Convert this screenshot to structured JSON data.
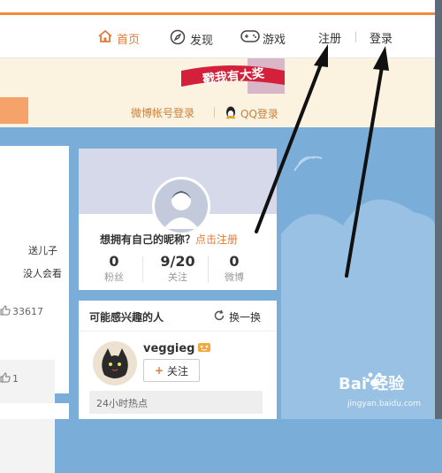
{
  "nav": {
    "home_label": "首页",
    "discover_label": "发现",
    "games_label": "游戏",
    "register_label": "注册",
    "login_label": "登录"
  },
  "banner": {
    "promo_text": "戳我有大奖",
    "weibo_login": "微博帐号登录",
    "qq_login": "QQ登录"
  },
  "left_feed": {
    "text_line1": "送儿子",
    "text_line2": "没人会看",
    "like_count": "33617",
    "like_count2": "1"
  },
  "profile": {
    "prompt_text": "想拥有自己的昵称？",
    "prompt_link": "点击注册",
    "stats": [
      {
        "value": "0",
        "label": "粉丝"
      },
      {
        "value": "9/20",
        "label": "关注"
      },
      {
        "value": "0",
        "label": "微博"
      }
    ]
  },
  "interest": {
    "title": "可能感兴趣的人",
    "refresh_label": "换一换",
    "user_name": "veggieg",
    "follow_label": "关注",
    "hot_label": "24小时热点"
  },
  "watermark": {
    "brand": "Bai 经验",
    "url": "jingyan.baidu.com"
  },
  "colors": {
    "accent": "#e07b39",
    "sky": "#7aaed9",
    "banner_bg": "#fbf3df"
  }
}
